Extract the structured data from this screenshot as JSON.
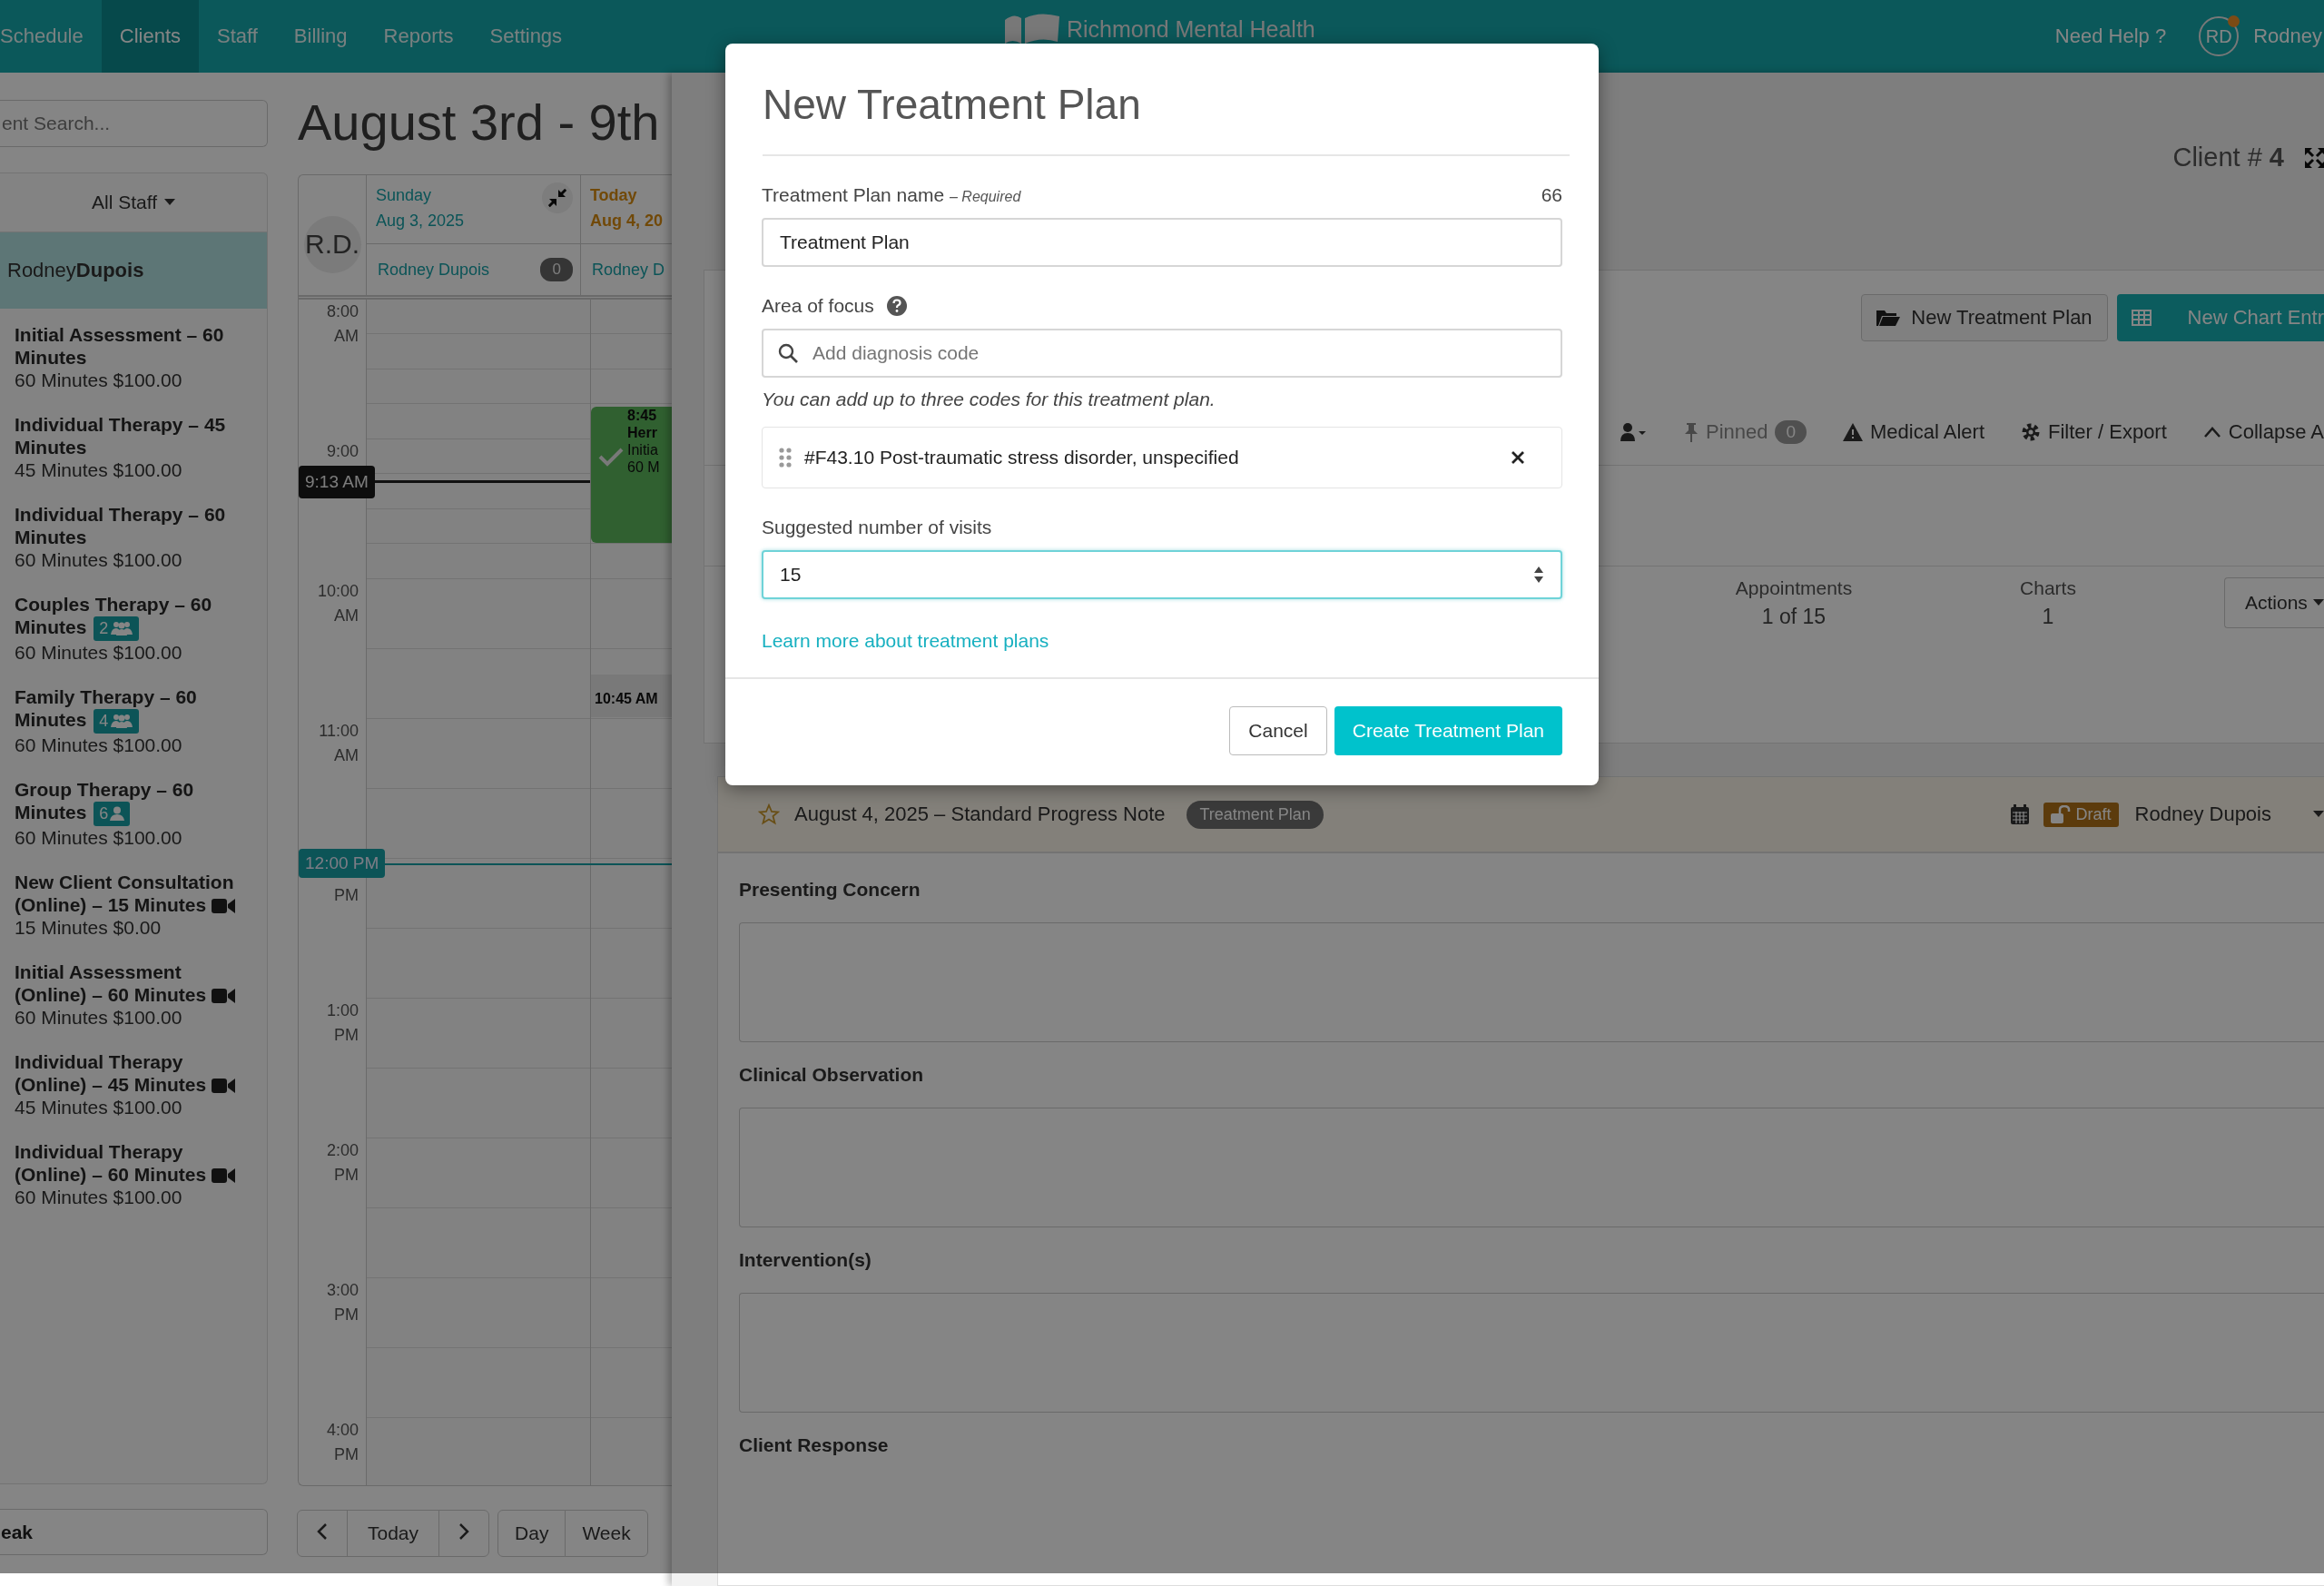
{
  "nav": {
    "items": [
      {
        "label": "Schedule",
        "selected": false
      },
      {
        "label": "Clients",
        "selected": true
      },
      {
        "label": "Staff",
        "selected": false
      },
      {
        "label": "Billing",
        "selected": false
      },
      {
        "label": "Reports",
        "selected": false
      },
      {
        "label": "Settings",
        "selected": false
      }
    ],
    "brand": "Richmond Mental Health",
    "help": "Need Help ?",
    "avatar": "RD",
    "user": "Rodney",
    "notification": true
  },
  "sidebar": {
    "search_placeholder": "ent Search...",
    "staff_filter": "All Staff",
    "staff": [
      {
        "first": "Rodney",
        "last": "Dupois",
        "selected": true
      }
    ],
    "services": [
      {
        "name": "Initial Assessment – 60 Minutes",
        "detail": "60 Minutes $100.00",
        "online": false
      },
      {
        "name": "Individual Therapy – 45 Minutes",
        "detail": "45 Minutes $100.00",
        "online": false
      },
      {
        "name": "Individual Therapy – 60 Minutes",
        "detail": "60 Minutes $100.00",
        "online": false
      },
      {
        "name": "Couples Therapy – 60 Minutes",
        "detail": "60 Minutes $100.00",
        "online": false,
        "badge": {
          "kind": "people",
          "count": "2"
        }
      },
      {
        "name": "Family Therapy – 60 Minutes",
        "detail": "60 Minutes $100.00",
        "online": false,
        "badge": {
          "kind": "people",
          "count": "4"
        }
      },
      {
        "name": "Group Therapy – 60 Minutes",
        "detail": "60 Minutes $100.00",
        "online": false,
        "badge": {
          "kind": "person",
          "count": "6"
        }
      },
      {
        "name": "New Client Consultation (Online) – 15 Minutes",
        "detail": "15 Minutes $0.00",
        "online": true
      },
      {
        "name": "Initial Assessment (Online) – 60 Minutes",
        "detail": "60 Minutes $100.00",
        "online": true
      },
      {
        "name": "Individual Therapy (Online) – 45 Minutes",
        "detail": "45 Minutes $100.00",
        "online": true
      },
      {
        "name": "Individual Therapy (Online) – 60 Minutes",
        "detail": "60 Minutes $100.00",
        "online": true
      }
    ],
    "footer_button": "eak"
  },
  "calendar": {
    "title": "August 3rd - 9th",
    "avatar": "R.D.",
    "days": [
      {
        "day": "Sunday",
        "date": "Aug 3, 2025",
        "today": false,
        "staff": "Rodney Dupois",
        "count": "0"
      },
      {
        "day": "Today",
        "date": "Aug 4, 20",
        "today": true,
        "staff": "Rodney D"
      }
    ],
    "hours": [
      {
        "hour": "8:00",
        "period": "AM"
      },
      {
        "hour": "9:00"
      },
      {
        "hour": "10:00",
        "period": "AM"
      },
      {
        "hour": "11:00",
        "period": "AM"
      },
      {
        "period": "PM"
      },
      {
        "hour": "1:00",
        "period": "PM"
      },
      {
        "hour": "2:00",
        "period": "PM"
      },
      {
        "hour": "3:00",
        "period": "PM"
      },
      {
        "hour": "4:00",
        "period": "PM"
      }
    ],
    "now_marker": "9:13 AM",
    "noon_marker": "12:00 PM",
    "events": [
      {
        "kind": "appointment",
        "lines": [
          "8:45",
          "Herr",
          "Initia",
          "60 M"
        ],
        "completed": true
      },
      {
        "kind": "block",
        "lines": [
          "10:45 AM"
        ],
        "completed": false
      }
    ],
    "toolbar": {
      "today": "Today",
      "views": [
        "Day",
        "Week"
      ]
    }
  },
  "client": {
    "number_label": "Client #",
    "number": "4",
    "actions": [
      {
        "label": "New Treatment Plan",
        "kind": "secondary"
      },
      {
        "label": "New Chart Entr",
        "kind": "primary"
      }
    ],
    "tools": [
      {
        "kind": "assignee",
        "disabled": false
      },
      {
        "kind": "pinned",
        "label": "Pinned",
        "count": "0",
        "disabled": true
      },
      {
        "kind": "alert",
        "label": "Medical Alert",
        "disabled": false
      },
      {
        "kind": "filter",
        "label": "Filter / Export",
        "disabled": false
      },
      {
        "kind": "collapse",
        "label": "Collapse A",
        "disabled": false
      }
    ],
    "stats": [
      {
        "label": "Appointments",
        "value": "1 of 15"
      },
      {
        "label": "Charts",
        "value": "1"
      }
    ],
    "actions_menu": "Actions",
    "note": {
      "starred": false,
      "title": "August 4, 2025 – Standard Progress Note",
      "tag": "Treatment Plan",
      "status": "Draft",
      "author": "Rodney Dupois",
      "sections": [
        {
          "label": "Presenting Concern",
          "kind": "field"
        },
        {
          "label": "Clinical Observation",
          "kind": "field"
        },
        {
          "label": "Intervention(s)",
          "kind": "field"
        },
        {
          "label": "Client Response",
          "kind": "heading"
        }
      ]
    }
  },
  "modal": {
    "title": "New Treatment Plan",
    "name_label": "Treatment Plan name",
    "required": "– Required",
    "char_count": "66",
    "name_value": "Treatment Plan",
    "focus_label": "Area of focus",
    "focus_placeholder": "Add diagnosis code",
    "focus_hint": "You can add up to three codes for this treatment plan.",
    "codes": [
      "#F43.10 Post-traumatic stress disorder, unspecified"
    ],
    "visits_label": "Suggested number of visits",
    "visits_value": "15",
    "visits_focused": true,
    "link": "Learn more about treatment plans",
    "buttons": [
      {
        "label": "Cancel",
        "kind": "secondary"
      },
      {
        "label": "Create Treatment Plan",
        "kind": "primary"
      }
    ]
  }
}
